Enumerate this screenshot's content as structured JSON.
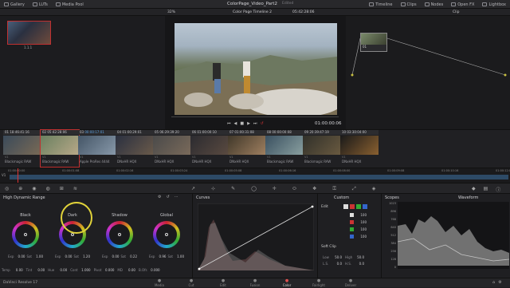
{
  "topbar": {
    "gallery": "Gallery",
    "luts": "LUTs",
    "media_pool": "Media Pool",
    "project_title": "ColorPage_Video_Part2",
    "edited": "Edited",
    "timeline": "Timeline",
    "clips": "Clips",
    "nodes": "Nodes",
    "openfx": "Open FX",
    "lightbox": "Lightbox"
  },
  "subbar": {
    "zoom": "32%",
    "timeline_name": "Color Page Timeline 2",
    "timecode": "05:42:28:06",
    "clip_mode": "Clip"
  },
  "gallery": {
    "still_label": "1.1.1"
  },
  "viewer": {
    "timecode": "01:00:00:06"
  },
  "nodes": {
    "node_label": "01"
  },
  "clips": [
    {
      "num": "01",
      "tc": "18:46:41:16",
      "codec": "Blackmagic RAW",
      "v": "V1"
    },
    {
      "num": "02",
      "tc": "05:42:28:06",
      "codec": "Blackmagic RAW",
      "v": "V1"
    },
    {
      "num": "03",
      "tc": "00:00:17:01",
      "codec": "Apple ProRes 4444",
      "v": "V1"
    },
    {
      "num": "04",
      "tc": "01:00:29:01",
      "codec": "DNxHR HQX",
      "v": "V1"
    },
    {
      "num": "05",
      "tc": "06:29:39:20",
      "codec": "DNxHR HQX",
      "v": "V1"
    },
    {
      "num": "06",
      "tc": "01:00:00:10",
      "codec": "DNxHR HQX",
      "v": "V1"
    },
    {
      "num": "07",
      "tc": "01:00:31:08",
      "codec": "DNxHR HQX",
      "v": "V1"
    },
    {
      "num": "08",
      "tc": "00:00:00:08",
      "codec": "Blackmagic RAW",
      "v": "V1"
    },
    {
      "num": "09",
      "tc": "20:39:47:19",
      "codec": "Blackmagic RAW",
      "v": "V1"
    },
    {
      "num": "10",
      "tc": "03:30:04:00",
      "codec": "DNxHR HQX",
      "v": "V1"
    }
  ],
  "timeline": {
    "ticks": [
      "01:00:00:00",
      "01:00:01:08",
      "01:00:02:16",
      "01:00:03:24",
      "01:00:05:08",
      "01:00:06:16",
      "01:00:08:00",
      "01:00:09:08",
      "01:00:10:16",
      "01:00:12:00"
    ],
    "track": "V1"
  },
  "panels": {
    "hdr_title": "High Dynamic Range",
    "wheels": [
      {
        "name": "Black",
        "exp": "0.00",
        "sat": "1.00"
      },
      {
        "name": "Dark",
        "exp": "0.00",
        "sat": "1.20"
      },
      {
        "name": "Shadow",
        "exp": "0.00",
        "sat": "0.22"
      },
      {
        "name": "Global",
        "exp": "0.96",
        "sat": "1.00"
      }
    ],
    "bottom_row": {
      "temp_label": "Temp",
      "temp": "0.00",
      "tint_label": "Tint",
      "tint": "0.00",
      "hue_label": "Hue",
      "hue": "0.00",
      "cont_label": "Cont",
      "cont": "1.000",
      "pivot_label": "Pivot",
      "pivot": "0.000",
      "md_label": "MD",
      "md": "0.00",
      "b_ofs_label": "B.Ofs",
      "b_ofs": "0.000"
    },
    "exp_label": "Exp",
    "sat_label": "Sat",
    "curves_title": "Curves",
    "custom_title": "Custom",
    "edit_label": "Edit",
    "values": [
      "100",
      "100",
      "100",
      "100"
    ],
    "soft_clip": "Soft Clip",
    "low_label": "Low",
    "low": "50.0",
    "high_label": "High",
    "high": "50.0",
    "ls_label": "L.S.",
    "ls": "0.0",
    "hs_label": "H.S.",
    "hs": "0.0",
    "scopes_title": "Scopes",
    "waveform": "Waveform",
    "scope_ticks": [
      "1023",
      "896",
      "768",
      "640",
      "512",
      "384",
      "256",
      "128",
      "0"
    ]
  },
  "pages": [
    {
      "label": "Media"
    },
    {
      "label": "Cut"
    },
    {
      "label": "Edit"
    },
    {
      "label": "Fusion"
    },
    {
      "label": "Color"
    },
    {
      "label": "Fairlight"
    },
    {
      "label": "Deliver"
    }
  ],
  "app_name": "DaVinci Resolve 17",
  "accent": "#e0d23a"
}
